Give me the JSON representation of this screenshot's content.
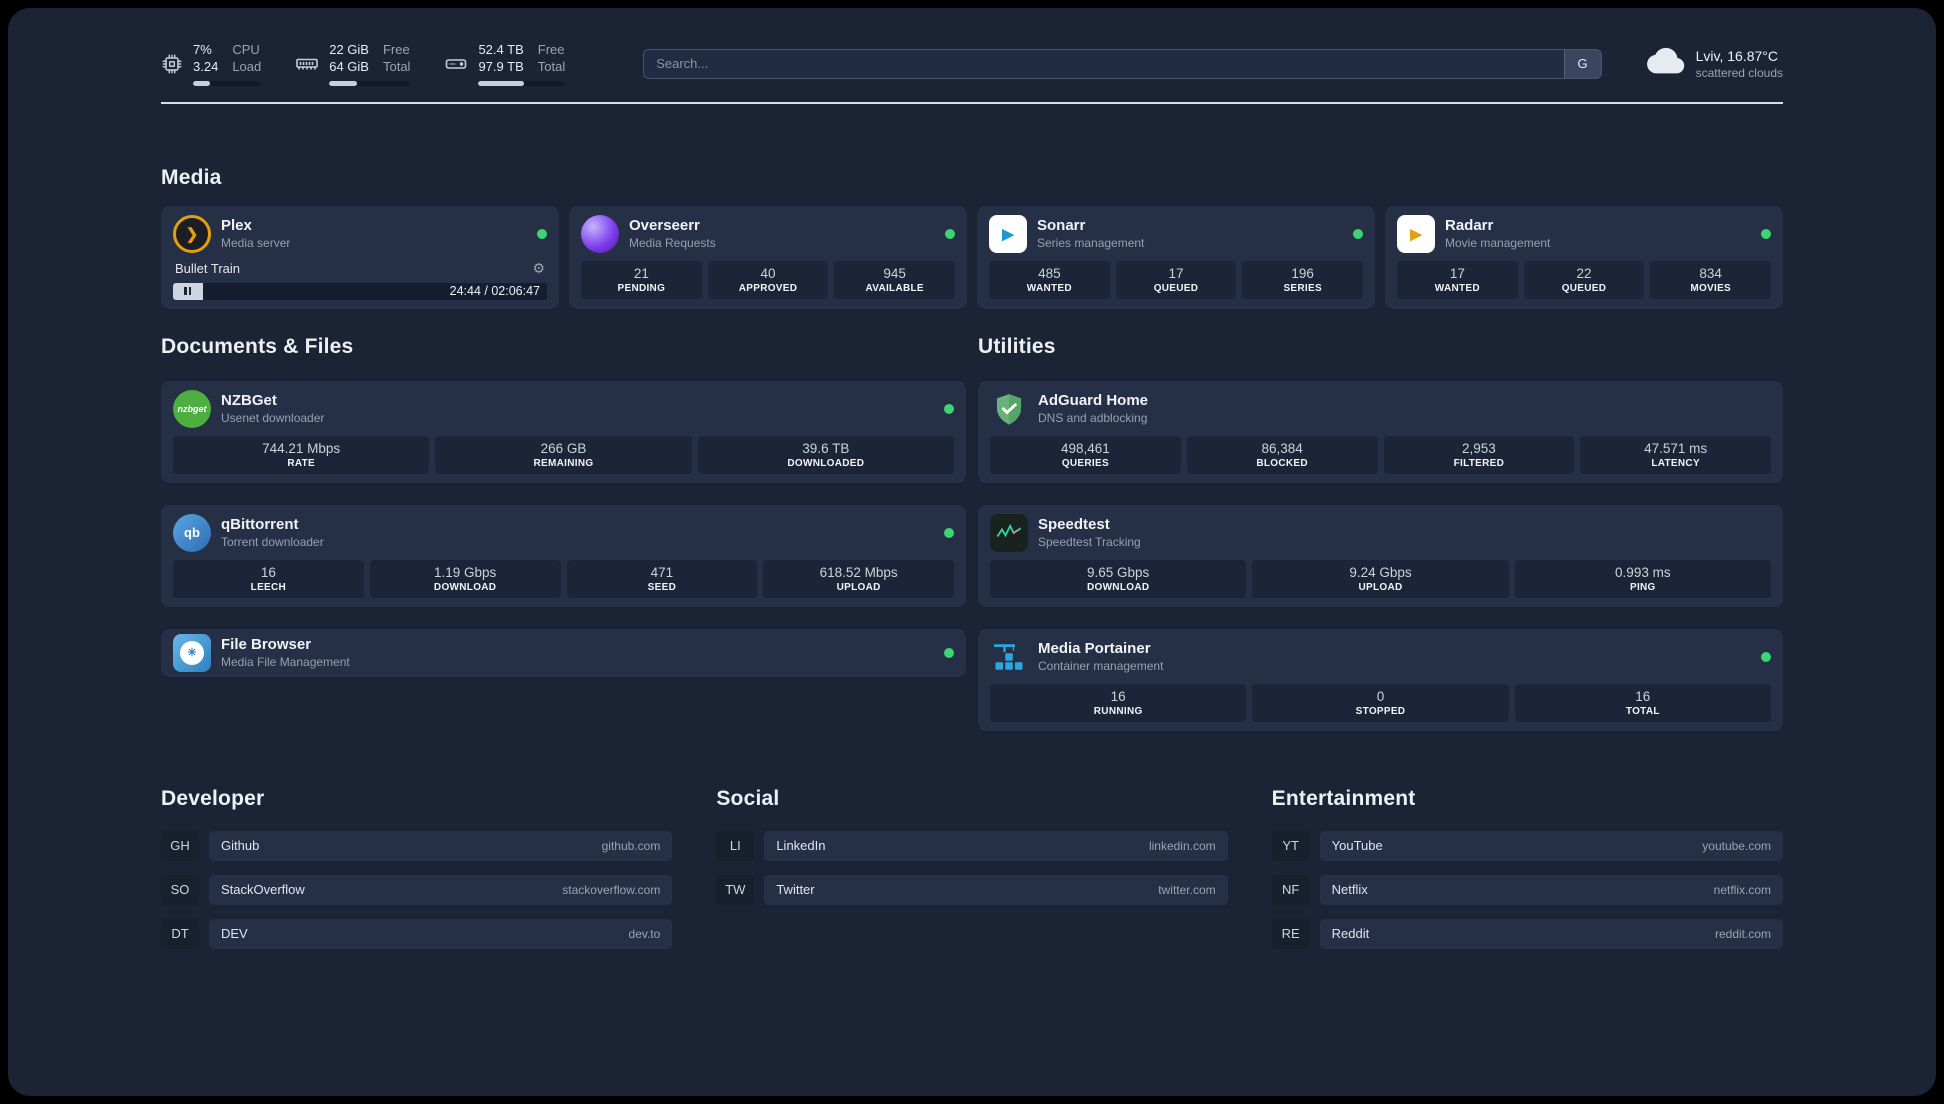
{
  "topbar": {
    "cpu": {
      "value1": "7%",
      "value2": "3.24",
      "label1": "CPU",
      "label2": "Load",
      "bar": "width:25%"
    },
    "memory": {
      "value1": "22 GiB",
      "value2": "64 GiB",
      "label1": "Free",
      "label2": "Total",
      "bar": "width:34%"
    },
    "disk": {
      "value1": "52.4 TB",
      "value2": "97.9 TB",
      "label1": "Free",
      "label2": "Total",
      "bar": "width:53%"
    },
    "search": {
      "placeholder": "Search...",
      "button": "G"
    },
    "weather": {
      "location": "Lviv, 16.87°C",
      "condition": "scattered clouds"
    }
  },
  "sections": {
    "media": "Media",
    "documents": "Documents & Files",
    "utilities": "Utilities",
    "developer": "Developer",
    "social": "Social",
    "entertainment": "Entertainment"
  },
  "icons": {
    "gear": "⚙",
    "plex_chevron": "❯",
    "play": "▶",
    "fb_mark": "✳"
  },
  "services": {
    "plex": {
      "name": "Plex",
      "subtitle": "Media server",
      "now_playing": "Bullet Train",
      "time": "24:44 / 02:06:47",
      "progress": "width:8%"
    },
    "overseerr": {
      "name": "Overseerr",
      "subtitle": "Media Requests",
      "stats": [
        {
          "value": "21",
          "label": "PENDING"
        },
        {
          "value": "40",
          "label": "APPROVED"
        },
        {
          "value": "945",
          "label": "AVAILABLE"
        }
      ]
    },
    "sonarr": {
      "name": "Sonarr",
      "subtitle": "Series management",
      "stats": [
        {
          "value": "485",
          "label": "WANTED"
        },
        {
          "value": "17",
          "label": "QUEUED"
        },
        {
          "value": "196",
          "label": "SERIES"
        }
      ]
    },
    "radarr": {
      "name": "Radarr",
      "subtitle": "Movie management",
      "stats": [
        {
          "value": "17",
          "label": "WANTED"
        },
        {
          "value": "22",
          "label": "QUEUED"
        },
        {
          "value": "834",
          "label": "MOVIES"
        }
      ]
    },
    "nzbget": {
      "name": "NZBGet",
      "subtitle": "Usenet downloader",
      "icon_text": "nzbget",
      "stats": [
        {
          "value": "744.21 Mbps",
          "label": "RATE"
        },
        {
          "value": "266 GB",
          "label": "REMAINING"
        },
        {
          "value": "39.6 TB",
          "label": "DOWNLOADED"
        }
      ]
    },
    "qbittorrent": {
      "name": "qBittorrent",
      "subtitle": "Torrent downloader",
      "icon_text": "qb",
      "stats": [
        {
          "value": "16",
          "label": "LEECH"
        },
        {
          "value": "1.19 Gbps",
          "label": "DOWNLOAD"
        },
        {
          "value": "471",
          "label": "SEED"
        },
        {
          "value": "618.52 Mbps",
          "label": "UPLOAD"
        }
      ]
    },
    "filebrowser": {
      "name": "File Browser",
      "subtitle": "Media File Management"
    },
    "adguard": {
      "name": "AdGuard Home",
      "subtitle": "DNS and adblocking",
      "stats": [
        {
          "value": "498,461",
          "label": "QUERIES"
        },
        {
          "value": "86,384",
          "label": "BLOCKED"
        },
        {
          "value": "2,953",
          "label": "FILTERED"
        },
        {
          "value": "47.571 ms",
          "label": "LATENCY"
        }
      ]
    },
    "speedtest": {
      "name": "Speedtest",
      "subtitle": "Speedtest Tracking",
      "stats": [
        {
          "value": "9.65 Gbps",
          "label": "DOWNLOAD"
        },
        {
          "value": "9.24 Gbps",
          "label": "UPLOAD"
        },
        {
          "value": "0.993 ms",
          "label": "PING"
        }
      ]
    },
    "portainer": {
      "name": "Media Portainer",
      "subtitle": "Container management",
      "stats": [
        {
          "value": "16",
          "label": "RUNNING"
        },
        {
          "value": "0",
          "label": "STOPPED"
        },
        {
          "value": "16",
          "label": "TOTAL"
        }
      ]
    }
  },
  "bookmarks": {
    "developer": [
      {
        "abbr": "GH",
        "name": "Github",
        "domain": "github.com"
      },
      {
        "abbr": "SO",
        "name": "StackOverflow",
        "domain": "stackoverflow.com"
      },
      {
        "abbr": "DT",
        "name": "DEV",
        "domain": "dev.to"
      }
    ],
    "social": [
      {
        "abbr": "LI",
        "name": "LinkedIn",
        "domain": "linkedin.com"
      },
      {
        "abbr": "TW",
        "name": "Twitter",
        "domain": "twitter.com"
      }
    ],
    "entertainment": [
      {
        "abbr": "YT",
        "name": "YouTube",
        "domain": "youtube.com"
      },
      {
        "abbr": "NF",
        "name": "Netflix",
        "domain": "netflix.com"
      },
      {
        "abbr": "RE",
        "name": "Reddit",
        "domain": "reddit.com"
      }
    ]
  }
}
